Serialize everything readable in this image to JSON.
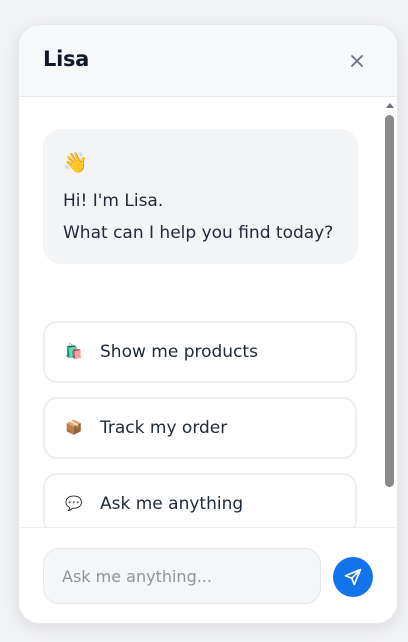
{
  "header": {
    "title": "Lisa"
  },
  "message": {
    "emoji": "👋",
    "line1": "Hi! I'm Lisa.",
    "line2": "What can I help you find today?"
  },
  "options": [
    {
      "icon": "🛍️",
      "icon_name": "shopping-bags-icon",
      "label": "Show me products"
    },
    {
      "icon": "📦",
      "icon_name": "package-icon",
      "label": "Track my order"
    },
    {
      "icon": "💬",
      "icon_name": "speech-bubble-icon",
      "label": "Ask me anything"
    }
  ],
  "composer": {
    "placeholder": "Ask me anything..."
  },
  "colors": {
    "accent": "#1273eb",
    "bubble_bg": "#f3f4f6",
    "header_bg": "#f7f8fa"
  }
}
